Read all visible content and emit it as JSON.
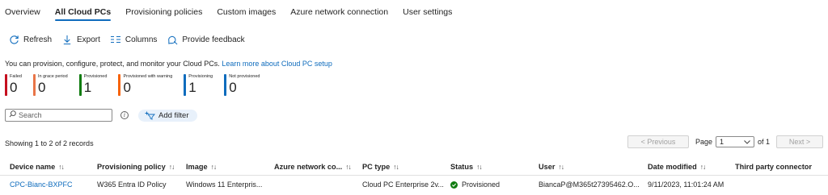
{
  "tabs": [
    {
      "label": "Overview",
      "active": false
    },
    {
      "label": "All Cloud PCs",
      "active": true
    },
    {
      "label": "Provisioning policies",
      "active": false
    },
    {
      "label": "Custom images",
      "active": false
    },
    {
      "label": "Azure network connection",
      "active": false
    },
    {
      "label": "User settings",
      "active": false
    }
  ],
  "toolbar": {
    "refresh": "Refresh",
    "export": "Export",
    "columns": "Columns",
    "feedback": "Provide feedback"
  },
  "description": {
    "text": "You can provision, configure, protect, and monitor your Cloud PCs.",
    "link": "Learn more about Cloud PC setup"
  },
  "tiles": [
    {
      "label": "Failed",
      "value": "0",
      "color": "#c50f1f"
    },
    {
      "label": "In grace period",
      "value": "0",
      "color": "#e97548"
    },
    {
      "label": "Provisioned",
      "value": "1",
      "color": "#107c10"
    },
    {
      "label": "Provisioned with warning",
      "value": "0",
      "color": "#f7630c"
    },
    {
      "label": "Provisioning",
      "value": "1",
      "color": "#0f6cbd"
    },
    {
      "label": "Not provisioned",
      "value": "0",
      "color": "#0f6cbd"
    }
  ],
  "search": {
    "placeholder": "Search"
  },
  "add_filter": "Add filter",
  "records": "Showing 1 to 2 of 2 records",
  "pager": {
    "previous": "< Previous",
    "page_label": "Page",
    "page_value": "1",
    "of_label": "of 1",
    "next": "Next >"
  },
  "table": {
    "columns": [
      {
        "label": "Device name",
        "sort": true
      },
      {
        "label": "Provisioning policy",
        "sort": true
      },
      {
        "label": "Image",
        "sort": true
      },
      {
        "label": "Azure network co...",
        "sort": true
      },
      {
        "label": "PC type",
        "sort": true
      },
      {
        "label": "Status",
        "sort": true
      },
      {
        "label": "User",
        "sort": true
      },
      {
        "label": "Date modified",
        "sort": true
      },
      {
        "label": "Third party connector",
        "sort": false
      }
    ],
    "sort_glyph": "↑↓",
    "rows": [
      {
        "device_name": "CPC-Bianc-BXPFC",
        "policy": "W365 Entra ID Policy",
        "image": "Windows 11 Enterpris...",
        "network": "",
        "pc_type": "Cloud PC Enterprise 2v...",
        "status": "Provisioned",
        "user": "BiancaP@M365t27395462.O...",
        "date_modified": "9/11/2023, 11:01:24 AM",
        "connector": ""
      }
    ]
  }
}
